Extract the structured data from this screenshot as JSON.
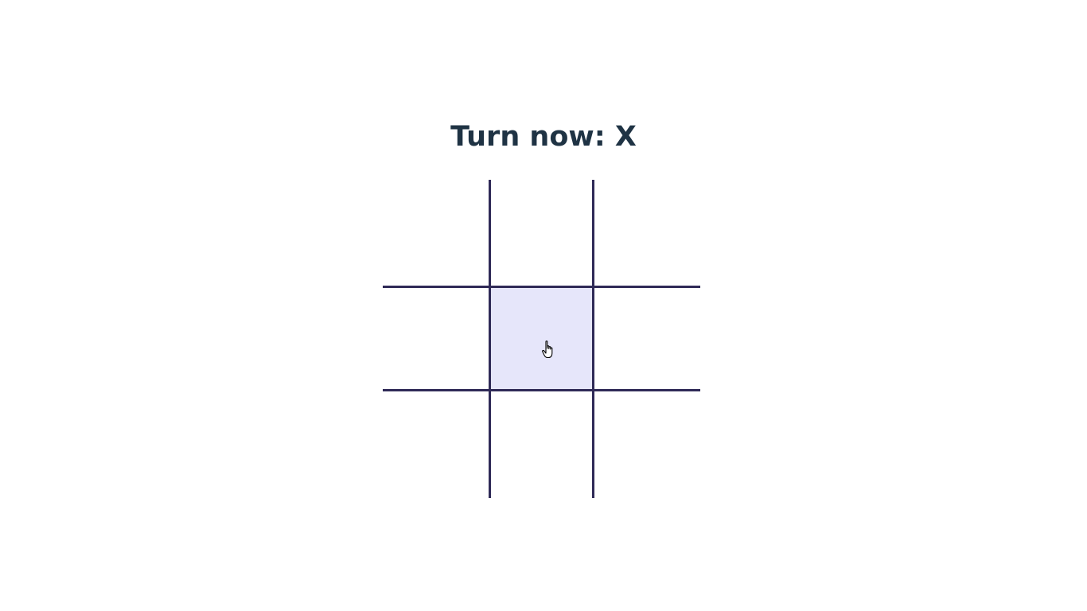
{
  "status": {
    "text": "Turn now: X"
  },
  "board": {
    "cells": [
      "",
      "",
      "",
      "",
      "",
      "",
      "",
      "",
      ""
    ],
    "hovered_cell": 4,
    "line_color": "#2f2a57",
    "hover_color": "#e6e6fa"
  },
  "colors": {
    "text": "#1f3344",
    "background": "#ffffff"
  }
}
